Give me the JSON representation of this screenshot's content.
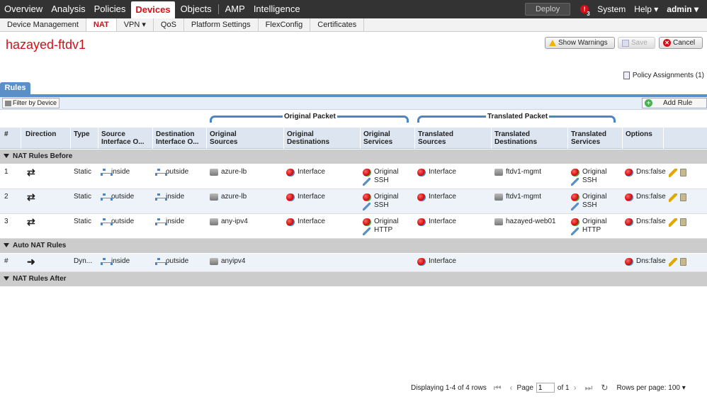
{
  "topnav": {
    "items": [
      "Overview",
      "Analysis",
      "Policies",
      "Devices",
      "Objects",
      "AMP",
      "Intelligence"
    ],
    "deploy": "Deploy",
    "alert_count": "3",
    "system": "System",
    "help": "Help ▾",
    "user": "admin ▾"
  },
  "subnav": {
    "items": [
      "Device Management",
      "NAT",
      "VPN ▾",
      "QoS",
      "Platform Settings",
      "FlexConfig",
      "Certificates"
    ]
  },
  "page": {
    "title": "hazayed-ftdv1",
    "show_warnings": "Show Warnings",
    "save": "Save",
    "cancel": "Cancel",
    "policy_assignments": "Policy Assignments (1)",
    "rules_tab": "Rules",
    "filter_by_device": "Filter by Device",
    "add_rule": "Add Rule"
  },
  "groups": {
    "original": "Original Packet",
    "translated": "Translated Packet"
  },
  "columns": [
    {
      "l1": "#",
      "l2": ""
    },
    {
      "l1": "Direction",
      "l2": ""
    },
    {
      "l1": "Type",
      "l2": ""
    },
    {
      "l1": "Source",
      "l2": "Interface O..."
    },
    {
      "l1": "Destination",
      "l2": "Interface O..."
    },
    {
      "l1": "Original",
      "l2": "Sources"
    },
    {
      "l1": "Original",
      "l2": "Destinations"
    },
    {
      "l1": "Original",
      "l2": "Services"
    },
    {
      "l1": "Translated",
      "l2": "Sources"
    },
    {
      "l1": "Translated",
      "l2": "Destinations"
    },
    {
      "l1": "Translated",
      "l2": "Services"
    },
    {
      "l1": "Options",
      "l2": ""
    }
  ],
  "sections": {
    "before": "NAT Rules Before",
    "auto": "Auto NAT Rules",
    "after": "NAT Rules After"
  },
  "rows": [
    {
      "num": "1",
      "type": "Static",
      "src_if": "inside",
      "dst_if": "outside",
      "orig_src": "azure-lb",
      "orig_dst": "Interface",
      "orig_svc1": "Original",
      "orig_svc2": "SSH",
      "tr_src": "Interface",
      "tr_dst": "ftdv1-mgmt",
      "tr_svc1": "Original",
      "tr_svc2": "SSH",
      "options": "Dns:false"
    },
    {
      "num": "2",
      "type": "Static",
      "src_if": "outside",
      "dst_if": "inside",
      "orig_src": "azure-lb",
      "orig_dst": "Interface",
      "orig_svc1": "Original",
      "orig_svc2": "SSH",
      "tr_src": "Interface",
      "tr_dst": "ftdv1-mgmt",
      "tr_svc1": "Original",
      "tr_svc2": "SSH",
      "options": "Dns:false"
    },
    {
      "num": "3",
      "type": "Static",
      "src_if": "outside",
      "dst_if": "inside",
      "orig_src": "any-ipv4",
      "orig_dst": "Interface",
      "orig_svc1": "Original",
      "orig_svc2": "HTTP",
      "tr_src": "Interface",
      "tr_dst": "hazayed-web01",
      "tr_svc1": "Original",
      "tr_svc2": "HTTP",
      "options": "Dns:false"
    }
  ],
  "auto_row": {
    "num": "#",
    "type": "Dyn...",
    "src_if": "inside",
    "dst_if": "outside",
    "orig_src": "anyipv4",
    "tr_src": "Interface",
    "options": "Dns:false"
  },
  "footer": {
    "displaying": "Displaying 1-4 of 4 rows",
    "page_label": "Page",
    "page_value": "1",
    "of_pages": "of 1",
    "rows_per_page": "Rows per page: 100 ▾"
  }
}
